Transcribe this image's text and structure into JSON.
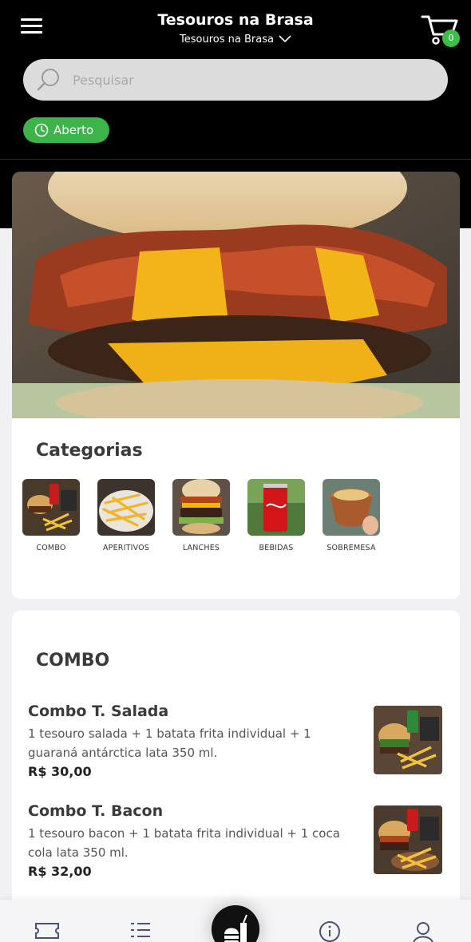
{
  "header": {
    "title": "Tesouros na Brasa",
    "store_selector": "Tesouros na Brasa",
    "cart_count": "0"
  },
  "search": {
    "placeholder": "Pesquisar",
    "value": ""
  },
  "status": {
    "label": "Aberto",
    "color": "#3cb44a"
  },
  "categories": {
    "title": "Categorias",
    "items": [
      {
        "label": "COMBO"
      },
      {
        "label": "APERITIVOS"
      },
      {
        "label": "LANCHES"
      },
      {
        "label": "BEBIDAS"
      },
      {
        "label": "SOBREMESA"
      }
    ]
  },
  "section": {
    "title": "COMBO",
    "products": [
      {
        "name": "Combo T. Salada",
        "description": "1 tesouro salada + 1 batata frita individual + 1 guaraná antárctica lata 350 ml.",
        "price": "R$ 30,00"
      },
      {
        "name": "Combo T. Bacon",
        "description": "1 tesouro bacon + 1 batata frita individual + 1 coca cola lata 350 ml.",
        "price": "R$ 32,00"
      }
    ]
  },
  "bottom_nav": {
    "items": [
      {
        "icon": "ticket-icon"
      },
      {
        "icon": "list-icon"
      },
      {
        "icon": "menu-food-icon"
      },
      {
        "icon": "info-icon"
      },
      {
        "icon": "user-icon"
      }
    ]
  },
  "colors": {
    "accent": "#3cb44a",
    "header_bg": "#000000"
  }
}
